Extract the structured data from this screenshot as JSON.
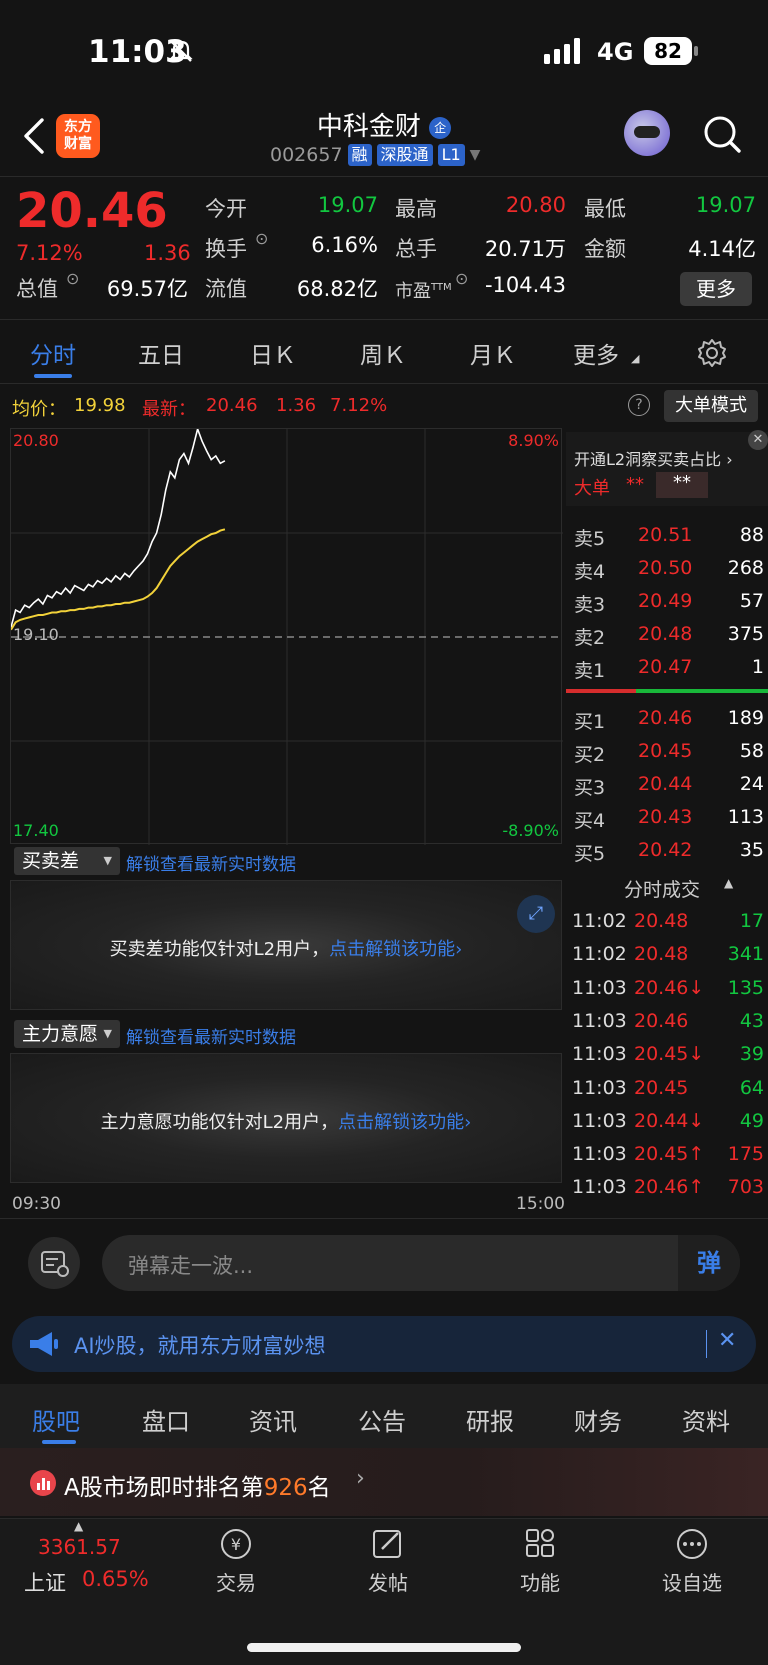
{
  "status": {
    "time": "11:03",
    "network": "4G",
    "battery": "82"
  },
  "header": {
    "logo": [
      "东方",
      "财富"
    ],
    "name": "中科金财",
    "code": "002657",
    "tags": [
      "融",
      "深股通",
      "L1"
    ]
  },
  "quote": {
    "price": "20.46",
    "change_pct": "7.12%",
    "change": "1.36",
    "fields": [
      {
        "label": "今开",
        "value": "19.07",
        "color": "green"
      },
      {
        "label": "最高",
        "value": "20.80",
        "color": "red"
      },
      {
        "label": "最低",
        "value": "19.07",
        "color": "green"
      },
      {
        "label": "换手",
        "value": "6.16%",
        "color": "white"
      },
      {
        "label": "总手",
        "value": "20.71万",
        "color": "white"
      },
      {
        "label": "金额",
        "value": "4.14亿",
        "color": "white"
      },
      {
        "label": "总值",
        "value": "69.57亿",
        "color": "white"
      },
      {
        "label": "流值",
        "value": "68.82亿",
        "color": "white"
      },
      {
        "label": "市盈",
        "value": "-104.43",
        "color": "white"
      }
    ],
    "pe_sup": "TTM",
    "more_label": "更多"
  },
  "tabs": [
    "分时",
    "五日",
    "日Ｋ",
    "周Ｋ",
    "月Ｋ",
    "更多"
  ],
  "infobar": {
    "avg_label": "均价：",
    "avg": "19.98",
    "latest_label": "最新：",
    "latest": "20.46",
    "change": "1.36",
    "pct": "7.12%",
    "big_order_label": "大单模式"
  },
  "chart_data": {
    "type": "line",
    "x_start": "09:30",
    "x_end": "15:00",
    "y_max": "20.80",
    "y_min": "17.40",
    "baseline": "19.10",
    "pct_max": "8.90%",
    "pct_min": "-8.90%",
    "ylim": [
      17.4,
      20.8
    ],
    "series": [
      {
        "color": "#ffffff",
        "values": [
          19.18,
          19.32,
          19.3,
          19.36,
          19.34,
          19.38,
          19.41,
          19.37,
          19.44,
          19.42,
          19.47,
          19.45,
          19.5,
          19.46,
          19.52,
          19.5,
          19.48,
          19.53,
          19.51,
          19.56,
          19.54,
          19.58,
          19.55,
          19.6,
          19.57,
          19.62,
          19.59,
          19.64,
          19.68,
          19.72,
          19.78,
          19.88,
          19.95,
          20.1,
          20.3,
          20.45,
          20.4,
          20.55,
          20.6,
          20.52,
          20.65,
          20.8,
          20.7,
          20.62,
          20.55,
          20.58,
          20.52,
          20.54
        ]
      },
      {
        "color": "#f2d23a",
        "values": [
          19.16,
          19.22,
          19.24,
          19.25,
          19.26,
          19.27,
          19.28,
          19.28,
          19.29,
          19.3,
          19.3,
          19.31,
          19.31,
          19.32,
          19.32,
          19.33,
          19.33,
          19.34,
          19.34,
          19.35,
          19.35,
          19.36,
          19.36,
          19.37,
          19.37,
          19.38,
          19.38,
          19.39,
          19.4,
          19.41,
          19.43,
          19.46,
          19.5,
          19.56,
          19.62,
          19.68,
          19.72,
          19.76,
          19.79,
          19.82,
          19.85,
          19.88,
          19.9,
          19.92,
          19.94,
          19.95,
          19.97,
          19.98
        ]
      }
    ]
  },
  "indicator1": {
    "select": "买卖差",
    "link": "解锁查看最新实时数据",
    "msg": "买卖差功能仅针对L2用户，",
    "msg_link": "点击解锁该功能"
  },
  "indicator2": {
    "select": "主力意愿",
    "link": "解锁查看最新实时数据",
    "msg": "主力意愿功能仅针对L2用户，",
    "msg_link": "点击解锁该功能"
  },
  "book": {
    "header": "开通L2洞察买卖占比",
    "big_label": "大单",
    "big_val1": "**",
    "big_val2": "**",
    "asks": [
      {
        "label": "卖5",
        "price": "20.51",
        "vol": "88"
      },
      {
        "label": "卖4",
        "price": "20.50",
        "vol": "268"
      },
      {
        "label": "卖3",
        "price": "20.49",
        "vol": "57"
      },
      {
        "label": "卖2",
        "price": "20.48",
        "vol": "375"
      },
      {
        "label": "卖1",
        "price": "20.47",
        "vol": "1"
      }
    ],
    "bids": [
      {
        "label": "买1",
        "price": "20.46",
        "vol": "189"
      },
      {
        "label": "买2",
        "price": "20.45",
        "vol": "58"
      },
      {
        "label": "买3",
        "price": "20.44",
        "vol": "24"
      },
      {
        "label": "买4",
        "price": "20.43",
        "vol": "113"
      },
      {
        "label": "买5",
        "price": "20.42",
        "vol": "35"
      }
    ],
    "ticks_title": "分时成交",
    "ticks": [
      {
        "time": "11:02",
        "price": "20.48",
        "arrow": "",
        "vol": "17",
        "vc": "green"
      },
      {
        "time": "11:02",
        "price": "20.48",
        "arrow": "",
        "vol": "341",
        "vc": "green"
      },
      {
        "time": "11:03",
        "price": "20.46",
        "arrow": "↓",
        "vol": "135",
        "vc": "green"
      },
      {
        "time": "11:03",
        "price": "20.46",
        "arrow": "",
        "vol": "43",
        "vc": "green"
      },
      {
        "time": "11:03",
        "price": "20.45",
        "arrow": "↓",
        "vol": "39",
        "vc": "green"
      },
      {
        "time": "11:03",
        "price": "20.45",
        "arrow": "",
        "vol": "64",
        "vc": "green"
      },
      {
        "time": "11:03",
        "price": "20.44",
        "arrow": "↓",
        "vol": "49",
        "vc": "green"
      },
      {
        "time": "11:03",
        "price": "20.45",
        "arrow": "↑",
        "vol": "175",
        "vc": "red"
      },
      {
        "time": "11:03",
        "price": "20.46",
        "arrow": "↑",
        "vol": "703",
        "vc": "red"
      }
    ]
  },
  "danmu": {
    "placeholder": "弹幕走一波...",
    "send_label": "弹"
  },
  "ai_banner": {
    "text": "AI炒股，就用东方财富妙想"
  },
  "subtabs": [
    "股吧",
    "盘口",
    "资讯",
    "公告",
    "研报",
    "财务",
    "资料"
  ],
  "rank": {
    "prefix": "A股市场即时排名第",
    "num": "926",
    "suffix": "名"
  },
  "bottomnav": {
    "index_value": "3361.57",
    "index_name": "上证",
    "index_pct": "0.65%",
    "items": [
      "交易",
      "发帖",
      "功能",
      "设自选"
    ]
  }
}
